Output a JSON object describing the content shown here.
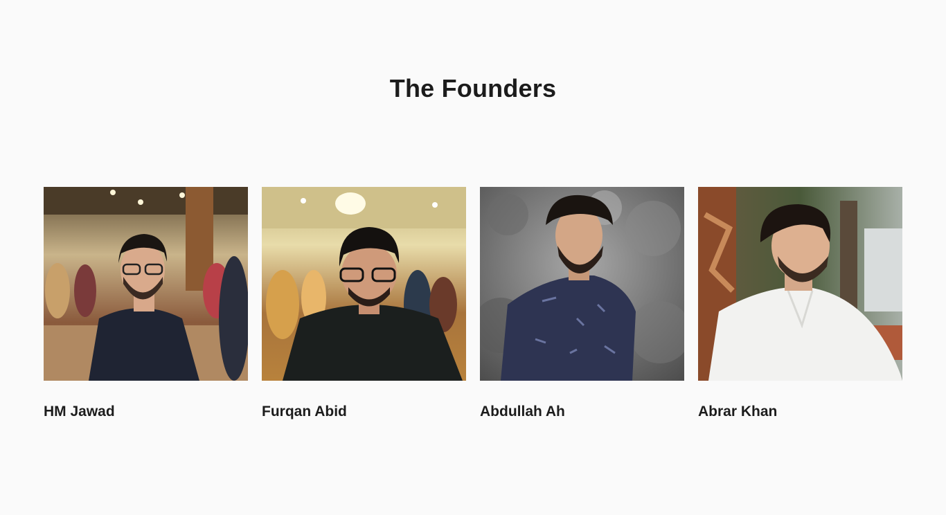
{
  "section": {
    "title": "The Founders"
  },
  "founders": [
    {
      "name": "HM Jawad",
      "photo_icon": "portrait-photo"
    },
    {
      "name": "Furqan Abid",
      "photo_icon": "portrait-photo"
    },
    {
      "name": "Abdullah Ah",
      "photo_icon": "portrait-photo"
    },
    {
      "name": "Abrar Khan",
      "photo_icon": "portrait-photo"
    }
  ],
  "colors": {
    "background": "#fafafa",
    "text": "#1c1c1c"
  }
}
